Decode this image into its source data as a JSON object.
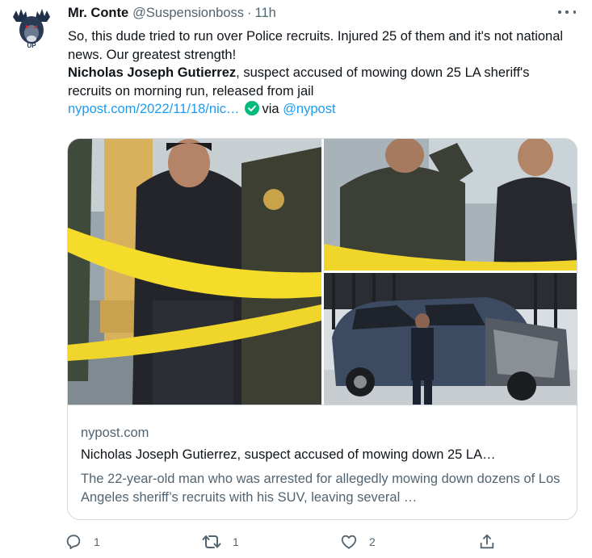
{
  "tweet": {
    "display_name": "Mr. Conte",
    "handle": "@Suspensionboss",
    "separator": "·",
    "time": "11h",
    "text_line": "So, this dude tried to run over Police recruits. Injured 25 of them and it's not national news. Our greatest strength!",
    "quote_name": "Nicholas Joseph Gutierrez",
    "quote_rest": ", suspect accused of mowing down 25 LA sheriff's recruits on morning run, released from jail",
    "link_text": "nypost.com/2022/11/18/nic…",
    "via_text": "via",
    "via_handle": "@nypost"
  },
  "card": {
    "domain": "nypost.com",
    "title": "Nicholas Joseph Gutierrez, suspect accused of mowing down 25 LA…",
    "description": "The 22-year-old man who was arrested for allegedly mowing down dozens of Los Angeles sheriff’s recruits with his SUV, leaving several …"
  },
  "actions": {
    "reply_count": "1",
    "retweet_count": "1",
    "like_count": "2"
  },
  "colors": {
    "link": "#1d9bf0",
    "secondary_text": "#536471",
    "border": "#cfd9de",
    "verified": "#00ba7c"
  }
}
